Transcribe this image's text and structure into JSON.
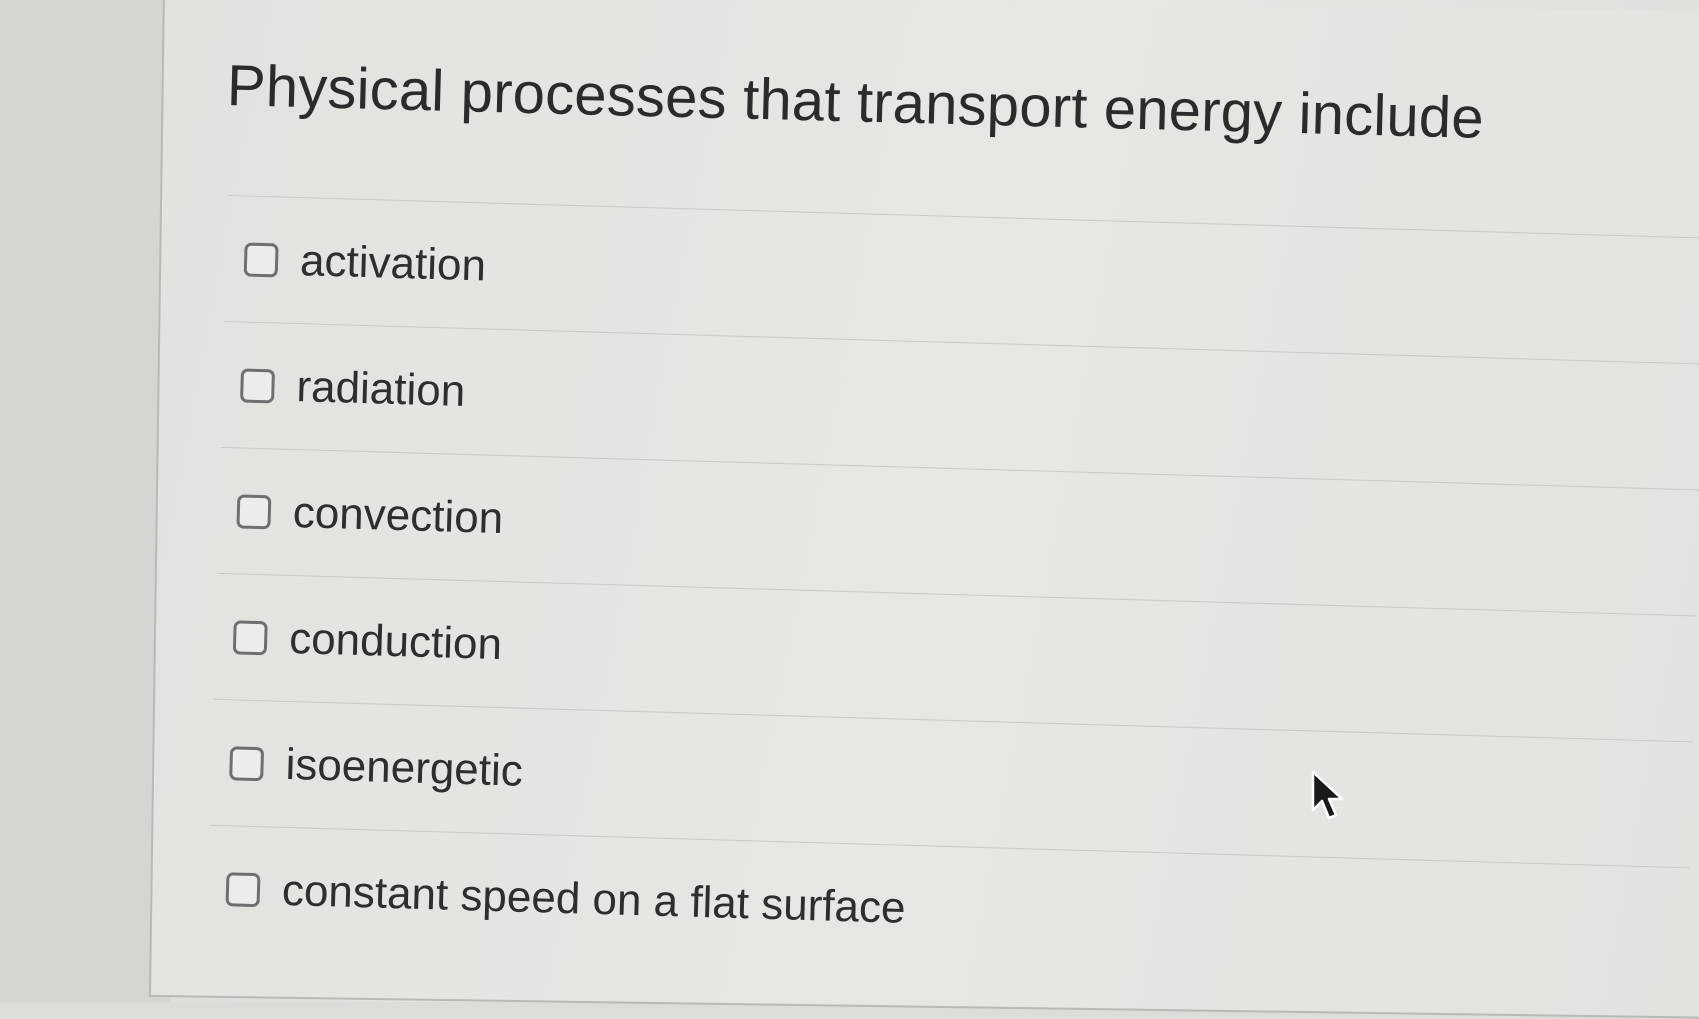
{
  "question": {
    "text": "Physical processes that transport energy include"
  },
  "options": [
    {
      "label": "activation",
      "checked": false
    },
    {
      "label": "radiation",
      "checked": false
    },
    {
      "label": "convection",
      "checked": false
    },
    {
      "label": "conduction",
      "checked": false
    },
    {
      "label": "isoenergetic",
      "checked": false
    },
    {
      "label": "constant speed on a flat surface",
      "checked": false
    }
  ],
  "cursor": {
    "icon": "mouse-pointer-icon"
  }
}
